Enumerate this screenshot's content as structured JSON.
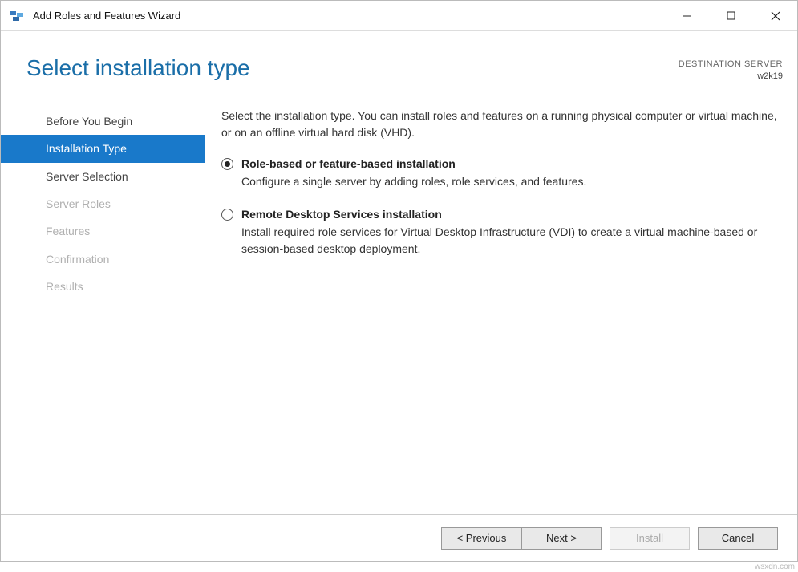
{
  "window": {
    "title": "Add Roles and Features Wizard"
  },
  "header": {
    "page_title": "Select installation type",
    "dest_label": "DESTINATION SERVER",
    "dest_value": "w2k19"
  },
  "nav": {
    "items": [
      {
        "label": "Before You Begin",
        "state": "normal"
      },
      {
        "label": "Installation Type",
        "state": "active"
      },
      {
        "label": "Server Selection",
        "state": "normal"
      },
      {
        "label": "Server Roles",
        "state": "disabled"
      },
      {
        "label": "Features",
        "state": "disabled"
      },
      {
        "label": "Confirmation",
        "state": "disabled"
      },
      {
        "label": "Results",
        "state": "disabled"
      }
    ]
  },
  "main": {
    "intro": "Select the installation type. You can install roles and features on a running physical computer or virtual machine, or on an offline virtual hard disk (VHD).",
    "options": [
      {
        "label": "Role-based or feature-based installation",
        "desc": "Configure a single server by adding roles, role services, and features.",
        "selected": true
      },
      {
        "label": "Remote Desktop Services installation",
        "desc": "Install required role services for Virtual Desktop Infrastructure (VDI) to create a virtual machine-based or session-based desktop deployment.",
        "selected": false
      }
    ]
  },
  "buttons": {
    "previous": "< Previous",
    "next": "Next >",
    "install": "Install",
    "cancel": "Cancel"
  },
  "watermark": "wsxdn.com"
}
